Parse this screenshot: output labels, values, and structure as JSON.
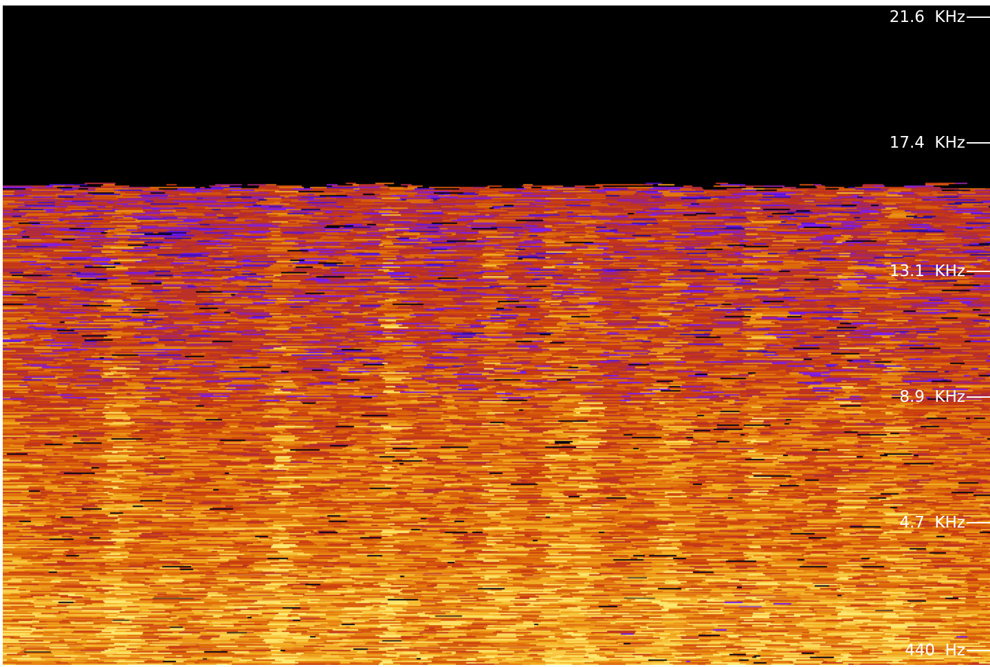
{
  "chart_data": {
    "type": "heatmap",
    "title": "",
    "xlabel": "",
    "ylabel": "",
    "y_ticks": [
      {
        "label": "21.6  KHz",
        "value_hz": 21600
      },
      {
        "label": "17.4  KHz",
        "value_hz": 17400
      },
      {
        "label": "13.1  KHz",
        "value_hz": 13100
      },
      {
        "label": "8.9  KHz",
        "value_hz": 8900
      },
      {
        "label": "4.7  KHz",
        "value_hz": 4700
      },
      {
        "label": "440  Hz",
        "value_hz": 440
      }
    ],
    "frequency_cutoff_hz": 16000,
    "colormap": [
      "#000000",
      "#2a0a8a",
      "#7a1cff",
      "#b02a3a",
      "#c83a10",
      "#e0700a",
      "#f4b020",
      "#ffe870"
    ],
    "bright_column_bands": [
      0.105,
      0.272,
      0.383,
      0.484,
      0.55,
      0.58,
      0.665,
      0.755,
      0.845,
      0.893
    ],
    "background": "#000000",
    "axis_text_color": "#ffffff"
  }
}
